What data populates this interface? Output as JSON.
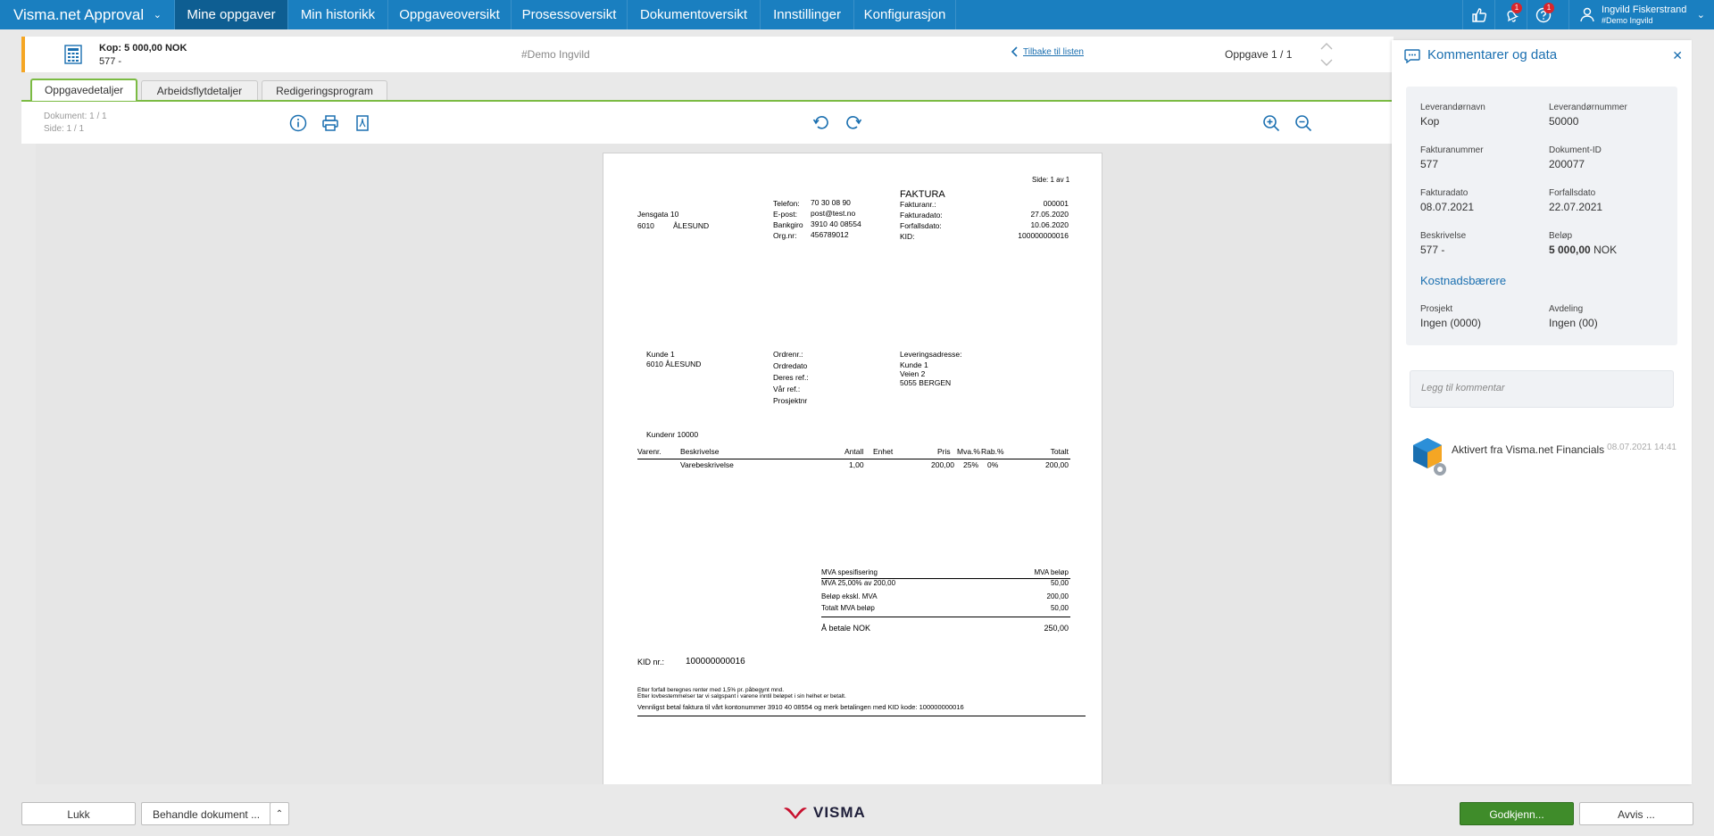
{
  "app": {
    "brand": "Visma.net Approval"
  },
  "nav": {
    "tabs": [
      "Mine oppgaver",
      "Min historikk",
      "Oppgaveoversikt",
      "Prosessoversikt",
      "Dokumentoversikt",
      "Innstillinger",
      "Konfigurasjon"
    ],
    "active_index": 0,
    "badges": {
      "bell": "1",
      "help": "1"
    },
    "user_name": "Ingvild Fiskerstrand",
    "user_sub": "#Demo Ingvild"
  },
  "task": {
    "title": "Kop: 5 000,00 NOK",
    "subtitle": "577 -",
    "tag": "#Demo Ingvild",
    "back_link": "Tilbake til listen",
    "count": "Oppgave 1 / 1"
  },
  "doc_tabs": [
    "Oppgavedetaljer",
    "Arbeidsflytdetaljer",
    "Redigeringsprogram"
  ],
  "toolbar": {
    "document_counter": "Dokument: 1 / 1",
    "page_counter": "Side: 1 / 1"
  },
  "invoice": {
    "page_of": "Side: 1 av 1",
    "heading": "FAKTURA",
    "sender_address": [
      "Jensgata 10",
      "6010",
      "ÅLESUND"
    ],
    "contact_labels": [
      "Telefon:",
      "E-post:",
      "Bankgiro",
      "Org.nr:"
    ],
    "contact_values": [
      "70 30 08 90",
      "post@test.no",
      "3910 40 08554",
      "456789012"
    ],
    "invoice_labels": [
      "Fakturanr.:",
      "Fakturadato:",
      "Forfallsdato:",
      "KID:"
    ],
    "invoice_values": [
      "000001",
      "27.05.2020",
      "10.06.2020",
      "100000000016"
    ],
    "customer": [
      "Kunde 1",
      "6010 ÅLESUND"
    ],
    "order_labels": [
      "Ordrenr.:",
      "Ordredato",
      "Deres ref.:",
      "Vår ref.:",
      "Prosjektnr"
    ],
    "delivery_heading": "Leveringsadresse:",
    "delivery": [
      "Kunde 1",
      "Veien 2",
      "5055 BERGEN"
    ],
    "customer_no": "Kundenr  10000",
    "columns": [
      "Varenr.",
      "Beskrivelse",
      "Antall",
      "Enhet",
      "Pris",
      "Mva.%",
      "Rab.%",
      "Totalt"
    ],
    "line": {
      "description": "Varebeskrivelse",
      "qty": "1,00",
      "price": "200,00",
      "vat": "25%",
      "discount": "0%",
      "total": "200,00"
    },
    "vat_spec_label": "MVA spesifisering",
    "vat_amount_label": "MVA beløp",
    "vat_rows": [
      {
        "label": "MVA 25,00% av 200,00",
        "value": "50,00"
      },
      {
        "label": "Beløp ekskl. MVA",
        "value": "200,00"
      },
      {
        "label": "Totalt MVA beløp",
        "value": "50,00"
      }
    ],
    "to_pay_label": "Å betale NOK",
    "to_pay_value": "250,00",
    "kid_label": "KID nr.:",
    "kid_value": "100000000016",
    "footer_1": "Etter forfall beregnes renter med 1,5% pr. påbegynt mnd.",
    "footer_2": "Etter lovbestemmelser tar vi salgspant i varene inntil beløpet i sin helhet er betalt.",
    "footer_3": "Vennligst betal faktura til vårt kontonummer  3910 40 08554   og merk betalingen med KID kode:   100000000016"
  },
  "panel": {
    "title": "Kommentarer og data",
    "fields": [
      {
        "label": "Leverandørnavn",
        "value": "Kop"
      },
      {
        "label": "Leverandørnummer",
        "value": "50000"
      },
      {
        "label": "Fakturanummer",
        "value": "577"
      },
      {
        "label": "Dokument-ID",
        "value": "200077"
      },
      {
        "label": "Fakturadato",
        "value": "08.07.2021"
      },
      {
        "label": "Forfallsdato",
        "value": "22.07.2021"
      },
      {
        "label": "Beskrivelse",
        "value": "577 -"
      },
      {
        "label": "Beløp",
        "value": "5 000,00",
        "unit": "NOK"
      }
    ],
    "cost_heading": "Kostnadsbærere",
    "cost_fields": [
      {
        "label": "Prosjekt",
        "value": "Ingen (0000)"
      },
      {
        "label": "Avdeling",
        "value": "Ingen (00)"
      }
    ],
    "comment_placeholder": "Legg til kommentar",
    "activity_text": "Aktivert fra Visma.net Financials",
    "activity_time": "08.07.2021 14:41"
  },
  "bottom": {
    "close": "Lukk",
    "handle": "Behandle dokument ...",
    "logo": "VISMA",
    "approve": "Godkjenn...",
    "reject": "Avvis ..."
  },
  "colors": {
    "nav": "#1a7fc0",
    "nav_active": "#0e5e92",
    "accent_green": "#7bbb43",
    "approve": "#3f8c2a",
    "link": "#1a6fb0",
    "task_marker": "#f5a623"
  }
}
